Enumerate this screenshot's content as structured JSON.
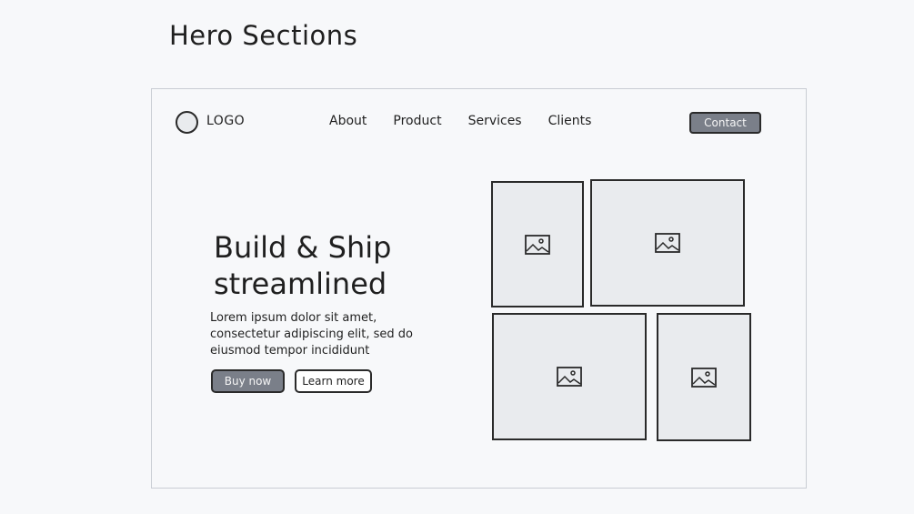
{
  "page": {
    "title": "Hero Sections"
  },
  "nav": {
    "logo": "LOGO",
    "links": [
      {
        "label": "About"
      },
      {
        "label": "Product"
      },
      {
        "label": "Services"
      },
      {
        "label": "Clients"
      }
    ],
    "contact_label": "Contact"
  },
  "hero": {
    "headline_line1": "Build & Ship",
    "headline_line2": "streamlined",
    "body": "Lorem ipsum dolor sit amet, consectetur adipiscing elit, sed do eiusmod tempor incididunt",
    "primary_cta": "Buy now",
    "secondary_cta": "Learn more"
  },
  "gallery": {
    "icon": "image-placeholder-icon",
    "count": 4
  },
  "colors": {
    "button_fill": "#7a7f89",
    "placeholder_fill": "#e9ebee",
    "stroke": "#2a2a2a",
    "frame_border": "#c9cdd4"
  }
}
